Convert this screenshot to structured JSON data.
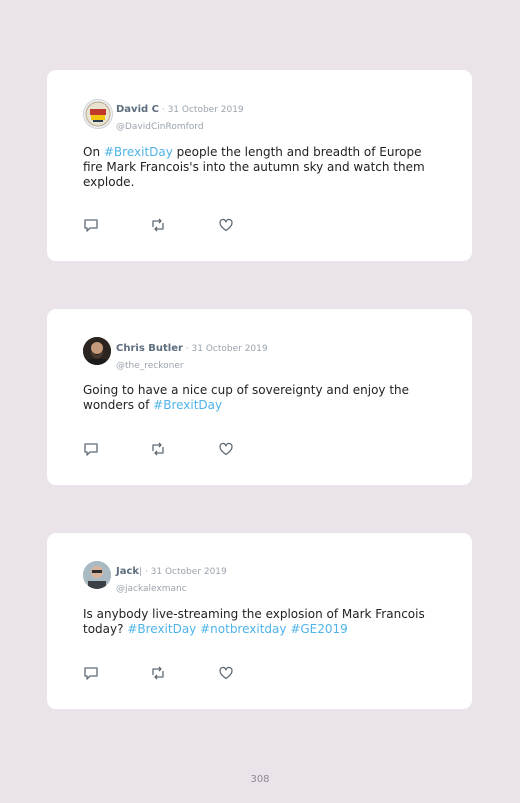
{
  "colors": {
    "background": "#eae3ea",
    "card": "#ffffff",
    "hashtag": "#4fb3e8",
    "name": "#5d6d7e",
    "muted": "#9aa3ad"
  },
  "tweets": [
    {
      "name": "David C",
      "date": " · 31 October 2019",
      "handle": "@DavidCinRomford",
      "avatar_icon": "brexit-badge-avatar",
      "text_parts": [
        "On ",
        "#BrexitDay",
        " people the length and breadth of Europe fire Mark Francois's into the autumn sky and watch them explode."
      ]
    },
    {
      "name": "Chris Butler",
      "date": " · 31 October 2019",
      "handle": "@the_reckoner",
      "avatar_icon": "bearded-man-avatar",
      "text_parts": [
        "Going to have a nice cup of sovereignty and enjoy the wonders of ",
        "#BrexitDay"
      ]
    },
    {
      "name": "Jack",
      "date": "| · 31 October 2019",
      "handle": "@jackalexmanc",
      "avatar_icon": "man-avatar",
      "text_parts": [
        "Is anybody live-streaming the explosion of Mark Francois today? ",
        "#BrexitDay",
        " ",
        "#notbrexitday",
        " ",
        "#GE2019"
      ]
    }
  ],
  "action_icons": [
    "reply-icon",
    "retweet-icon",
    "like-icon"
  ],
  "page_number": "308"
}
